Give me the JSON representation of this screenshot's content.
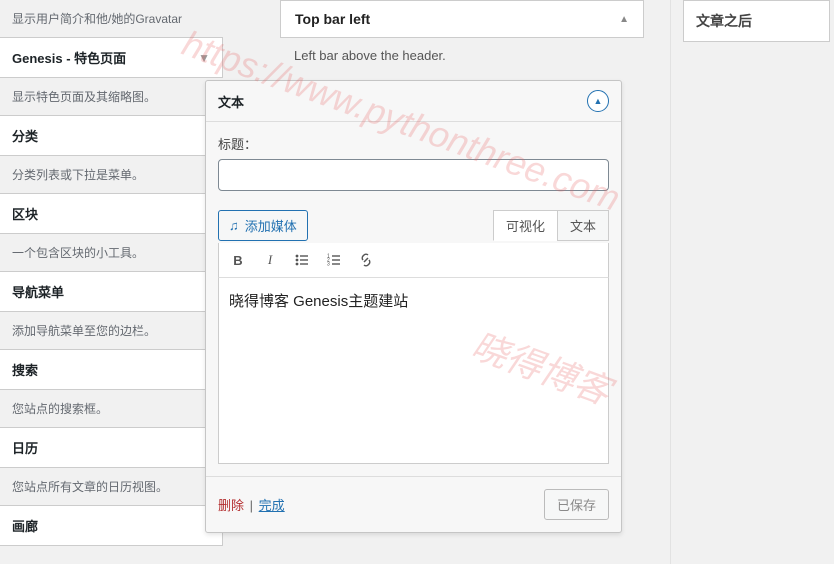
{
  "sidebar": {
    "items": [
      {
        "desc_above": "显示用户简介和他/她的Gravatar",
        "title": "Genesis - 特色页面",
        "desc": "显示特色页面及其缩略图。"
      },
      {
        "title": "分类",
        "desc": "分类列表或下拉是菜单。"
      },
      {
        "title": "区块",
        "desc": "一个包含区块的小工具。"
      },
      {
        "title": "导航菜单",
        "desc": "添加导航菜单至您的边栏。"
      },
      {
        "title": "搜索",
        "desc": "您站点的搜索框。"
      },
      {
        "title": "日历",
        "desc": "您站点所有文章的日历视图。"
      },
      {
        "title": "画廊",
        "desc": ""
      }
    ]
  },
  "center": {
    "panel_title": "Top bar left",
    "panel_sub": "Left bar above the header."
  },
  "editor": {
    "widget_title": "文本",
    "title_label": "标题：",
    "title_value": "",
    "add_media": "添加媒体",
    "tab_visual": "可视化",
    "tab_text": "文本",
    "content": "晓得博客 Genesis主题建站",
    "delete": "删除",
    "done": "完成",
    "saved": "已保存"
  },
  "right": {
    "box_title": "文章之后"
  },
  "watermarks": {
    "w1": "https://www.pythonthree.com",
    "w2": "晓得博客"
  }
}
